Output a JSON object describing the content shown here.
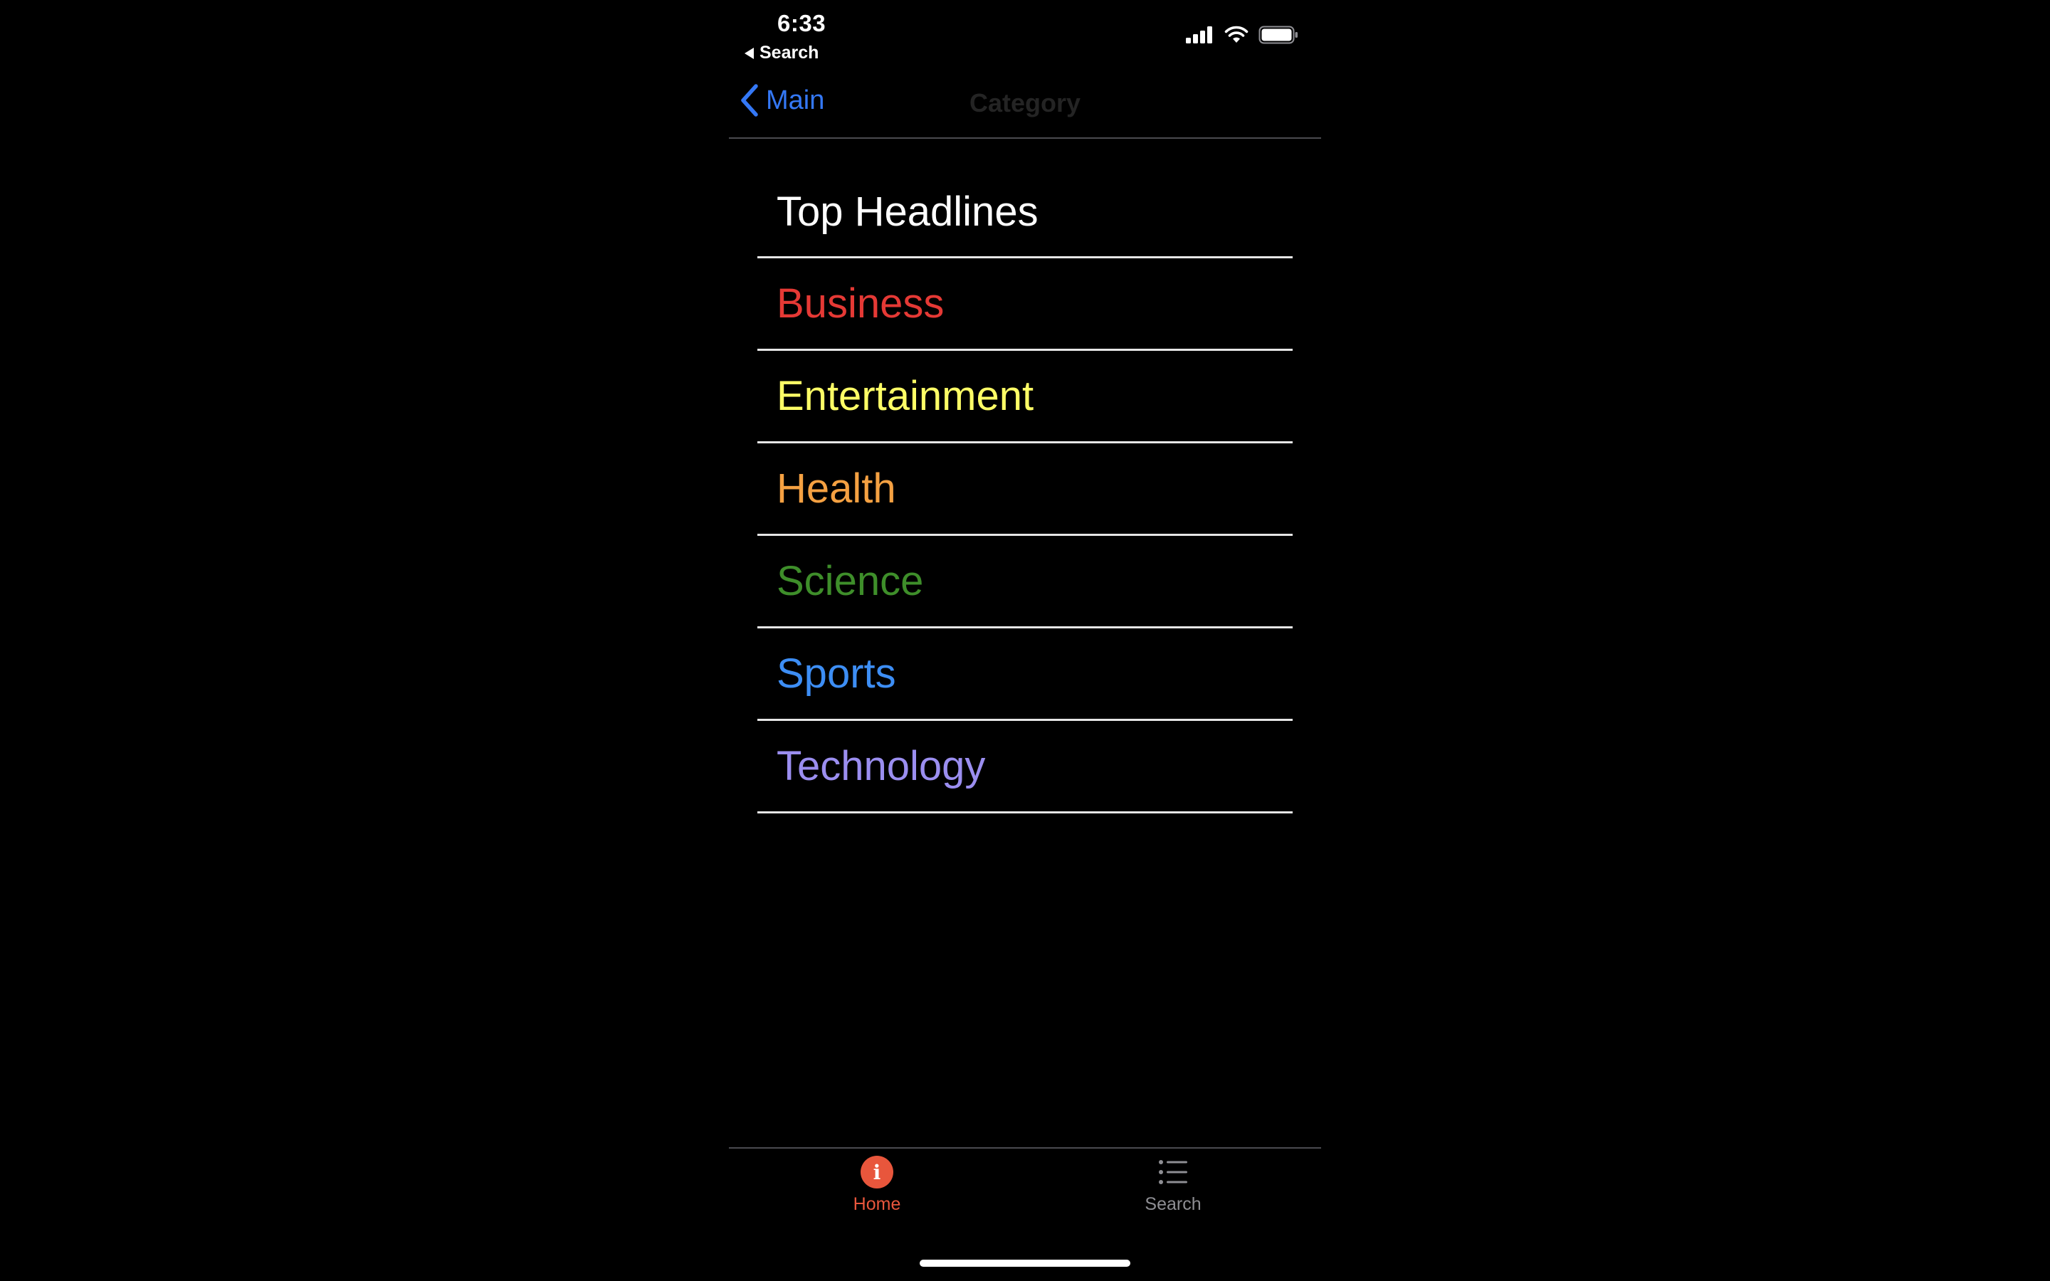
{
  "status_bar": {
    "time": "6:33",
    "back_app_label": "Search",
    "icons": [
      "cellular-signal-icon",
      "wifi-icon",
      "battery-icon"
    ]
  },
  "nav_bar": {
    "back_label": "Main",
    "title": "Category"
  },
  "categories": [
    {
      "label": "Top Headlines",
      "color": "#ffffff"
    },
    {
      "label": "Business",
      "color": "#e53935"
    },
    {
      "label": "Entertainment",
      "color": "#ffff66"
    },
    {
      "label": "Health",
      "color": "#f5a142"
    },
    {
      "label": "Science",
      "color": "#3e8e2a"
    },
    {
      "label": "Sports",
      "color": "#3d8ef5"
    },
    {
      "label": "Technology",
      "color": "#9b8ef0"
    }
  ],
  "tab_bar": {
    "tabs": [
      {
        "label": "Home",
        "icon": "info-circle-icon",
        "selected": true,
        "color": "#e8563c"
      },
      {
        "label": "Search",
        "icon": "list-icon",
        "selected": false,
        "color": "#8e8e93"
      }
    ]
  },
  "colors": {
    "accent": "#3478f6",
    "background": "#000000"
  }
}
